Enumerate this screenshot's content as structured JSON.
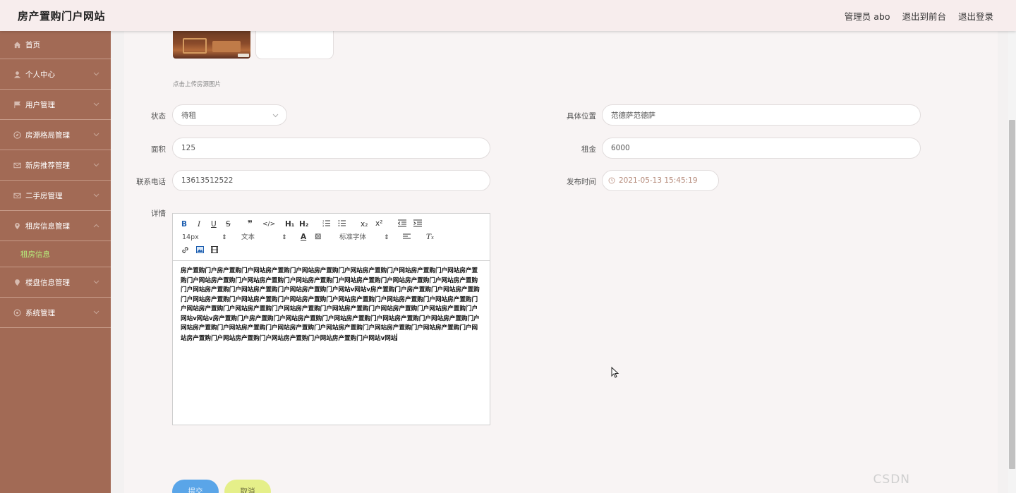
{
  "header": {
    "brand": "房产置购门户网站",
    "user": "管理员 abo",
    "to_front": "退出到前台",
    "logout": "退出登录"
  },
  "sidebar": {
    "items": [
      {
        "label": "首页",
        "icon": "home-icon"
      },
      {
        "label": "个人中心",
        "icon": "user-icon"
      },
      {
        "label": "用户管理",
        "icon": "flag-icon"
      },
      {
        "label": "房源格局管理",
        "icon": "compass-icon"
      },
      {
        "label": "新房推荐管理",
        "icon": "mail-icon"
      },
      {
        "label": "二手房管理",
        "icon": "envelope-icon"
      },
      {
        "label": "租房信息管理",
        "icon": "location-icon"
      },
      {
        "label": "楼盘信息管理",
        "icon": "pin-icon"
      },
      {
        "label": "系统管理",
        "icon": "gear-icon"
      }
    ],
    "active_sub": "租房信息"
  },
  "form": {
    "upload_hint": "点击上传房源图片",
    "status_label": "状态",
    "status_value": "待租",
    "location_label": "具体位置",
    "location_value": "范德萨范德萨",
    "area_label": "面积",
    "area_value": "125",
    "rent_label": "租金",
    "rent_value": "6000",
    "phone_label": "联系电话",
    "phone_value": "13613512522",
    "publish_label": "发布时间",
    "publish_value": "2021-05-13 15:45:19",
    "detail_label": "详情"
  },
  "editor": {
    "font_size": "14px",
    "block_format": "文本",
    "font_family": "标准字体",
    "content": "房产置购门户房产置购门户网站房产置购门户网站房产置购门户网站房产置购门户网站房产置购门户网站房产置购门户网站房产置购门户网站房产置购门户网站房产置购门户网站房产置购门户网站房产置购门户网站房产置购门户网站房产置购门户网站房产置购门户网站房产置购门户网站v网站v房产置购门户房产置购门户网站房产置购门户网站房产置购门户网站房产置购门户网站房产置购门户网站房产置购门户网站房产置购门户网站房产置购门户网站房产置购门户网站房产置购门户网站房产置购门户网站房产置购门户网站房产置购门户网站房产置购门户网站v网站v房产置购门户房产置购门户网站房产置购门户网站房产置购门户网站房产置购门户网站房产置购门户网站房产置购门户网站房产置购门户网站房产置购门户网站房产置购门户网站房产置购门户网站房产置购门户网站房产置购门户网站房产置购门户网站房产置购门户网站房产置购门户网站v网站"
  },
  "buttons": {
    "submit": "提交",
    "cancel": "取消"
  },
  "watermark": "CSDN",
  "colors": {
    "sidebar": "#a26a55",
    "header": "#f7eded",
    "active_sub": "#b7f07c",
    "submit": "#5aa5e8",
    "cancel": "#e5ef89"
  }
}
